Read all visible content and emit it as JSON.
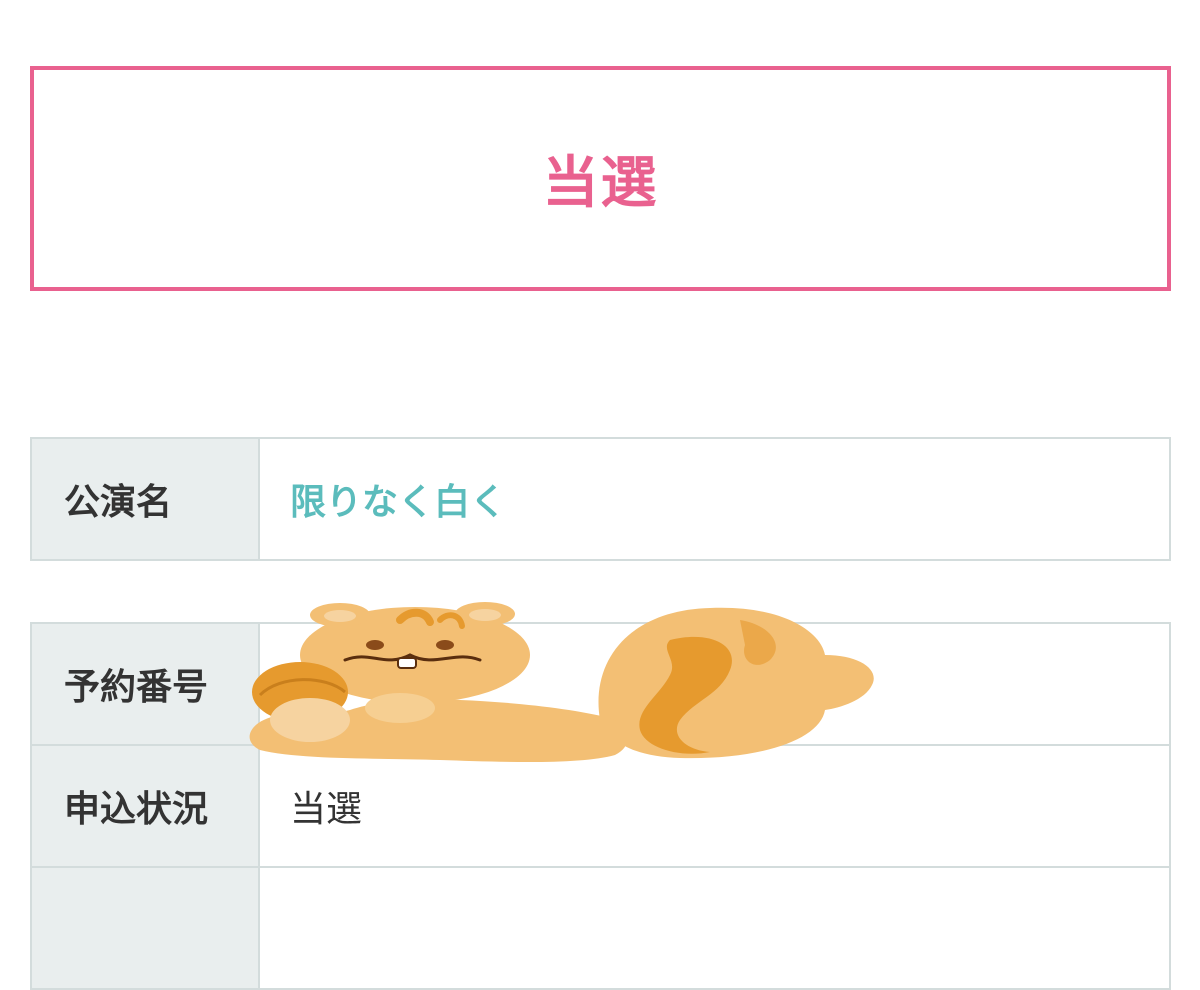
{
  "result": {
    "status_label": "当選",
    "accent_color": "#e9618f"
  },
  "event_table": {
    "rows": [
      {
        "header": "公演名",
        "value": "限りなく白く"
      }
    ]
  },
  "reservation_table": {
    "rows": [
      {
        "header": "予約番号",
        "value": ""
      },
      {
        "header": "申込状況",
        "value": "当選"
      },
      {
        "header": "",
        "value": ""
      }
    ]
  },
  "colors": {
    "header_bg": "#e9eeee",
    "border": "#d3dcdc",
    "link": "#5bbcbc",
    "text": "#333333"
  },
  "overlay": {
    "icon": "squirrel-sticker-icon"
  }
}
